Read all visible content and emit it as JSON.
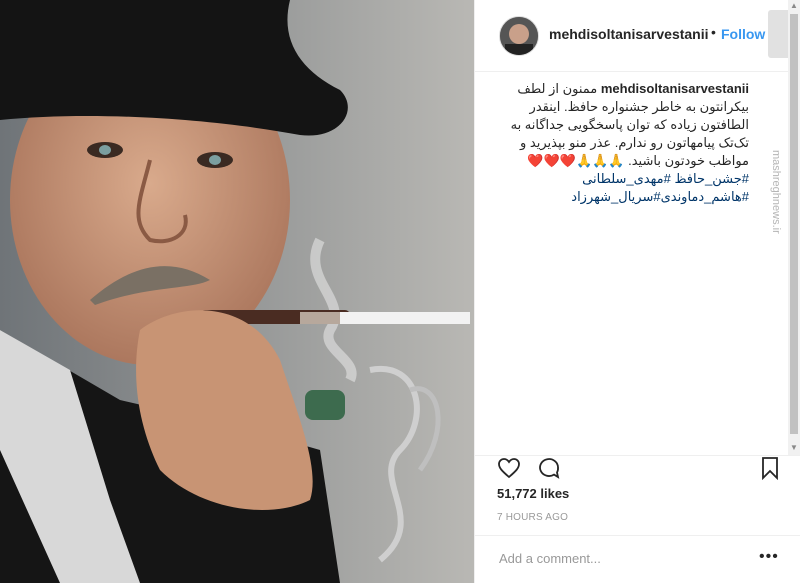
{
  "post": {
    "username": "mehdisoltanisarvestanii",
    "separator": "•",
    "follow_label": "Follow",
    "caption": {
      "user": "mehdisoltanisarvestanii",
      "text": "ممنون از لطف بیکرانتون به خاطر جشنواره حافظ. اینقدر الطافتون زیاده که توان پاسخگویی جداگانه به تک‌تک پیامهاتون رو ندارم. عذر منو بپذیرید و مواظب خودتون باشید. 🙏🙏🙏❤️❤️❤️",
      "hashtags": "#جشن_حافظ #مهدی_سلطانی #هاشم_دماوندی#سریال_شهرزاد"
    },
    "likes": "51,772 likes",
    "time": "7 HOURS AGO",
    "comment_placeholder": "Add a comment...",
    "more_label": "•••"
  },
  "watermark": {
    "text": "mashreghnews.ir"
  },
  "icons": {
    "like": "heart-icon",
    "comment": "comment-icon",
    "save": "bookmark-icon"
  },
  "colors": {
    "follow": "#3897f0",
    "text": "#262626",
    "muted": "#999999",
    "hashtag": "#003569"
  }
}
